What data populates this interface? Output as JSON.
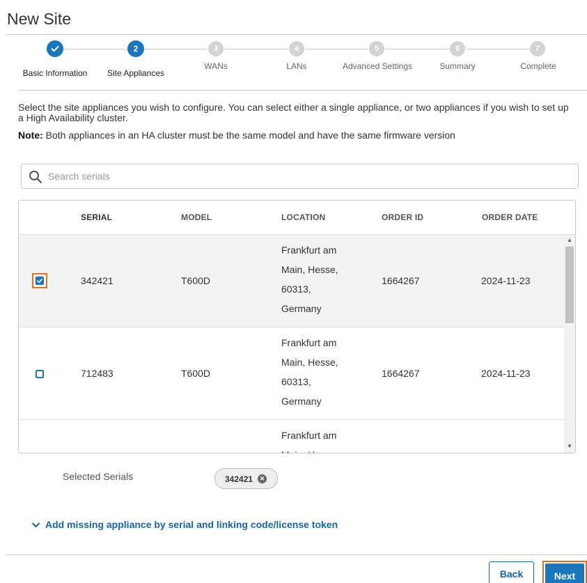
{
  "page": {
    "title": "New Site"
  },
  "stepper": {
    "steps": [
      {
        "number": "1",
        "label": "Basic Information",
        "state": "done"
      },
      {
        "number": "2",
        "label": "Site Appliances",
        "state": "active"
      },
      {
        "number": "3",
        "label": "WANs",
        "state": "pending"
      },
      {
        "number": "4",
        "label": "LANs",
        "state": "pending"
      },
      {
        "number": "5",
        "label": "Advanced Settings",
        "state": "pending"
      },
      {
        "number": "6",
        "label": "Summary",
        "state": "pending"
      },
      {
        "number": "7",
        "label": "Complete",
        "state": "pending"
      }
    ]
  },
  "intro": {
    "text": "Select the site appliances you wish to configure. You can select either a single appliance, or two appliances if you wish to set up a High Availability cluster.",
    "note_label": "Note:",
    "note_text": " Both appliances in an HA cluster must be the same model and have the same firmware version"
  },
  "search": {
    "placeholder": "Search serials",
    "value": ""
  },
  "table": {
    "headers": [
      "SERIAL",
      "MODEL",
      "LOCATION",
      "ORDER ID",
      "ORDER DATE"
    ],
    "rows": [
      {
        "checked": true,
        "serial": "342421",
        "model": "T600D",
        "location": [
          "Frankfurt am",
          "Main, Hesse,",
          "60313,",
          "Germany"
        ],
        "order_id": "1664267",
        "order_date": "2024-11-23"
      },
      {
        "checked": false,
        "serial": "712483",
        "model": "T600D",
        "location": [
          "Frankfurt am",
          "Main, Hesse,",
          "60313,",
          "Germany"
        ],
        "order_id": "1664267",
        "order_date": "2024-11-23"
      },
      {
        "checked": false,
        "serial": "",
        "model": "",
        "location": [
          "Frankfurt am",
          "Main, Hesse,"
        ],
        "order_id": "",
        "order_date": ""
      }
    ]
  },
  "selected": {
    "label": "Selected Serials",
    "chips": [
      "342421"
    ]
  },
  "add_missing": {
    "label": "Add missing appliance by serial and linking code/license token"
  },
  "footer": {
    "back_label": "Back",
    "next_label": "Next"
  },
  "colors": {
    "accent": "#1b76bb",
    "focus": "#e0731c",
    "link": "#1565a8"
  }
}
